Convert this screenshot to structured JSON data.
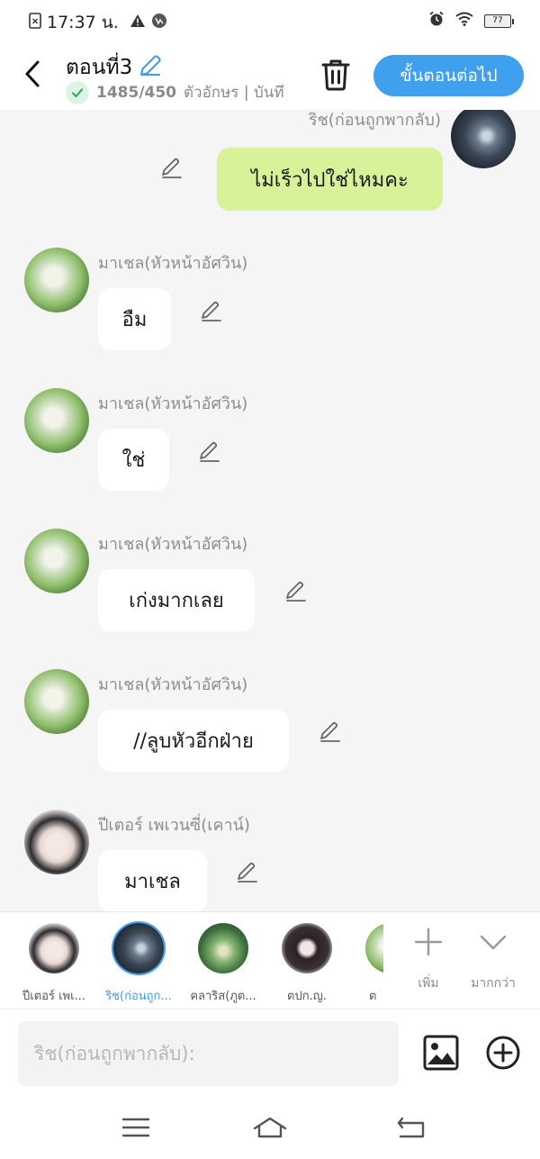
{
  "status_bar": {
    "time": "17:37 น."
  },
  "header": {
    "title": "ตอนที่3",
    "char_count": "1485/450",
    "char_count_suffix": "ตัวอักษร | บันทึ",
    "next_button": "ขั้นตอนต่อไป"
  },
  "chat": {
    "messages": [
      {
        "sender": "ริช(ก่อนถูกพากลับ)",
        "text": "ไม่เร็วไปใช่ไหมคะ"
      },
      {
        "sender": "มาเชล(หัวหน้าอัศวิน)",
        "text": "อืม"
      },
      {
        "sender": "มาเชล(หัวหน้าอัศวิน)",
        "text": "ใช่"
      },
      {
        "sender": "มาเชล(หัวหน้าอัศวิน)",
        "text": "เก่งมากเลย"
      },
      {
        "sender": "มาเชล(หัวหน้าอัศวิน)",
        "text": "//ลูบหัวอีกฝ่าย"
      },
      {
        "sender": "ปีเตอร์ เพเวนซี่(เคาน์)",
        "text": "มาเชล"
      }
    ]
  },
  "characters": [
    {
      "label": "ปีเตอร์ เพเ..."
    },
    {
      "label": "ริช(ก่อนถูก..."
    },
    {
      "label": "คลาริส(ภูต..."
    },
    {
      "label": "ตปก.ญ."
    },
    {
      "label": "ต"
    }
  ],
  "tools": {
    "add_label": "เพิ่ม",
    "more_label": "มากกว่า"
  },
  "input": {
    "placeholder": "ริช(ก่อนถูกพากลับ):"
  },
  "colors": {
    "accent": "#3fa0ee",
    "my_bubble": "#d8f29a",
    "check": "#2db55d"
  }
}
